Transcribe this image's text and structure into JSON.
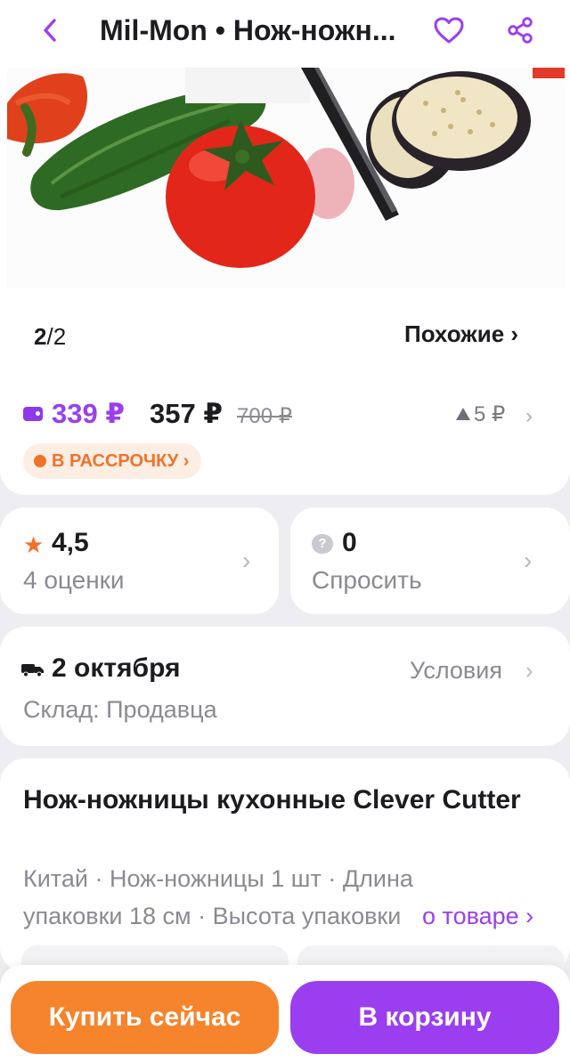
{
  "header": {
    "title": "Mil-Mon • Нож-ножн...",
    "icons": [
      "back-chevron-icon",
      "heart-icon",
      "share-icon"
    ]
  },
  "gallery": {
    "current": "2",
    "total": "2",
    "similar_label": "Похожие ›"
  },
  "price": {
    "wallet_price": "339 ₽",
    "regular_price": "357 ₽",
    "old_price": "700 ₽",
    "price_change": "5 ₽",
    "installment_label": "В РАССРОЧКУ ›"
  },
  "rating": {
    "value": "4,5",
    "count_label": "4 оценки"
  },
  "questions": {
    "count": "0",
    "label": "Спросить"
  },
  "delivery": {
    "date": "2 октября",
    "terms_label": "Условия",
    "warehouse": "Склад: Продавца"
  },
  "product": {
    "name": "Нож-ножницы кухонные Clever Cutter",
    "desc_line1": "Китай · Нож-ножницы 1 шт · Длина",
    "desc_line2": "упаковки 18 см · Высота упаковки",
    "about_link": "о товаре ›"
  },
  "actions": {
    "buy_now": "Купить сейчас",
    "add_to_cart": "В корзину"
  },
  "colors": {
    "accent_purple": "#9b3ef0",
    "accent_orange": "#f5842c"
  }
}
